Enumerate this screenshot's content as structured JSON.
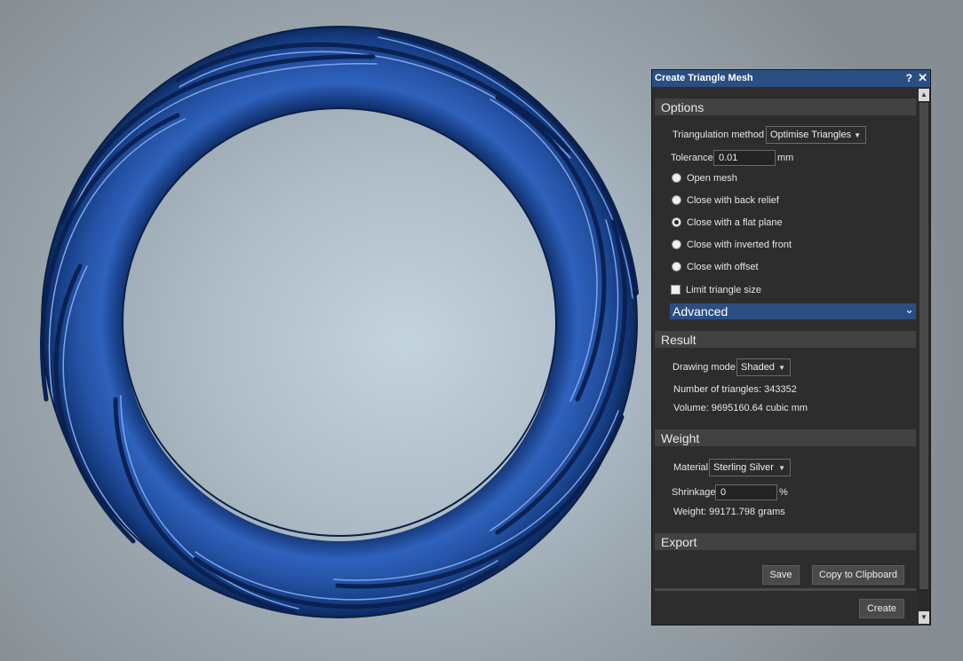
{
  "dialog": {
    "title": "Create Triangle Mesh",
    "help_glyph": "?",
    "close_glyph": "✕"
  },
  "options": {
    "header": "Options",
    "triangulation_label": "Triangulation method",
    "triangulation_value": "Optimise Triangles",
    "tolerance_label": "Tolerance",
    "tolerance_value": "0.01",
    "tolerance_unit": "mm",
    "radios": [
      {
        "label": "Open mesh",
        "checked": false
      },
      {
        "label": "Close with back relief",
        "checked": false
      },
      {
        "label": "Close with a flat plane",
        "checked": true
      },
      {
        "label": "Close with inverted front",
        "checked": false
      },
      {
        "label": "Close with offset",
        "checked": false
      }
    ],
    "limit_label": "Limit triangle size",
    "limit_checked": false,
    "advanced_label": "Advanced"
  },
  "result": {
    "header": "Result",
    "drawing_mode_label": "Drawing mode",
    "drawing_mode_value": "Shaded",
    "triangles_text": "Number of triangles: 343352",
    "volume_text": "Volume: 9695160.64 cubic mm"
  },
  "weight": {
    "header": "Weight",
    "material_label": "Material",
    "material_value": "Sterling Silver",
    "shrinkage_label": "Shrinkage",
    "shrinkage_value": "0",
    "shrinkage_unit": "%",
    "weight_text": "Weight: 99171.798 grams"
  },
  "export": {
    "header": "Export",
    "save_label": "Save",
    "copy_label": "Copy to Clipboard"
  },
  "footer": {
    "create_label": "Create"
  },
  "icons": {
    "dropdown": "dropdown-arrow-icon",
    "chevron": "chevron-down-icon"
  },
  "colors": {
    "accent": "#2b4f82",
    "ring": "#1d4a9a"
  }
}
